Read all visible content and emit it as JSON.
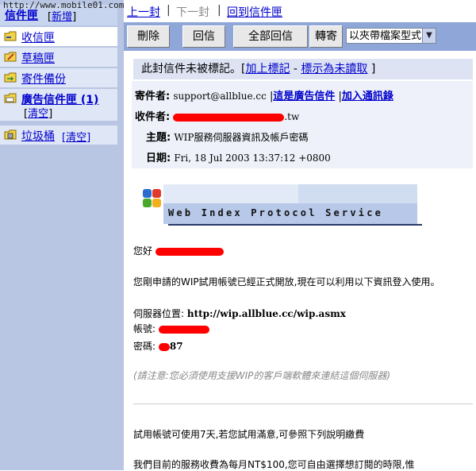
{
  "watermark": "http://www.mobile01.com",
  "sidebar": {
    "title": "信件匣",
    "new_label": "新增",
    "items": [
      {
        "label": "收信匣"
      },
      {
        "label": "草稿匣"
      },
      {
        "label": "寄件備份"
      },
      {
        "label": "廣告信件匣 (1)",
        "sub": "清空"
      },
      {
        "label": "垃圾桶",
        "sub": "清空"
      }
    ]
  },
  "topnav": {
    "prev": "上一封",
    "next": "下一封",
    "back": "回到信件匣",
    "sep": "|"
  },
  "toolbar": {
    "delete": "刪除",
    "reply": "回信",
    "reply_all": "全部回信",
    "forward": "轉寄",
    "folder_select": "以夾帶檔案型式"
  },
  "flag_bar": {
    "text": "此封信件未被標記。[",
    "mark": "加上標記",
    "dash": " - ",
    "unread": "標示為未讀取",
    "close": " ]"
  },
  "headers": {
    "from_label": "寄件者:",
    "from_value": "support@allblue.cc",
    "spam_link": "這是廣告信件",
    "add_contact": "加入通訊錄",
    "to_label": "收件者:",
    "to_value_suffix": ".tw",
    "subject_label": "主題:",
    "subject_value": "WIP服務伺服器資訊及帳戶密碼",
    "date_label": "日期:",
    "date_value": "Fri, 18 Jul 2003 13:37:12 +0800"
  },
  "logo": {
    "text": "Web Index Protocol Service"
  },
  "body": {
    "greeting": "您好",
    "line1": "您剛申請的WIP試用帳號已經正式開放,現在可以利用以下資訊登入使用。",
    "server_label": "伺服器位置:",
    "server_value": "http://wip.allblue.cc/wip.asmx",
    "account_label": "帳號:",
    "password_label": "密碼:",
    "password_suffix": "87",
    "note": "(請注意:您必須使用支援WIP的客戶端軟體來連結這個伺服器)",
    "trial": "試用帳號可使用7天,若您試用滿意,可參照下列說明繳費",
    "fee": "我們目前的服務收費為每月NT$100,您可自由選擇想訂閱的時限,惟"
  }
}
